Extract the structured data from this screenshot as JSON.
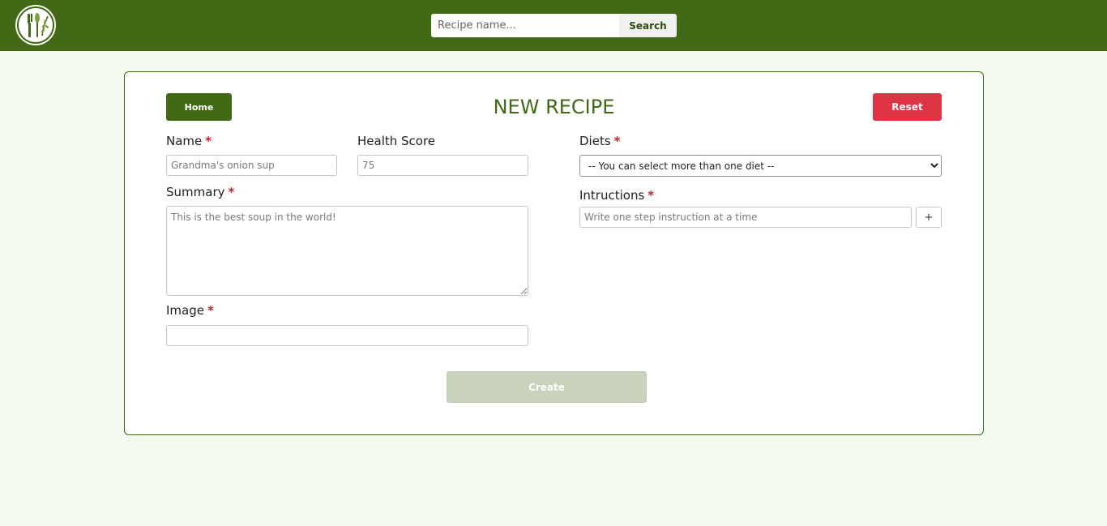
{
  "header": {
    "logo_icon": "recipe-logo-icon",
    "search": {
      "placeholder": "Recipe name...",
      "value": "",
      "button_label": "Search"
    }
  },
  "form": {
    "title": "NEW RECIPE",
    "home_label": "Home",
    "reset_label": "Reset",
    "required_mark": "*",
    "name": {
      "label": "Name",
      "placeholder": "Grandma's onion sup"
    },
    "health_score": {
      "label": "Health Score",
      "placeholder": "75"
    },
    "summary": {
      "label": "Summary",
      "placeholder": "This is the best soup in the world!"
    },
    "image": {
      "label": "Image",
      "placeholder": ""
    },
    "diets": {
      "label": "Diets",
      "selected": "-- You can select more than one diet --"
    },
    "instructions": {
      "label": "Intructions",
      "placeholder": "Write one step instruction at a time",
      "add_label": "+"
    },
    "create_label": "Create"
  },
  "colors": {
    "header_bg": "#426915",
    "page_bg": "#f3f9ee",
    "primary": "#426915",
    "danger": "#df3346",
    "disabled": "#c9d3bc",
    "required": "#c8202f"
  }
}
